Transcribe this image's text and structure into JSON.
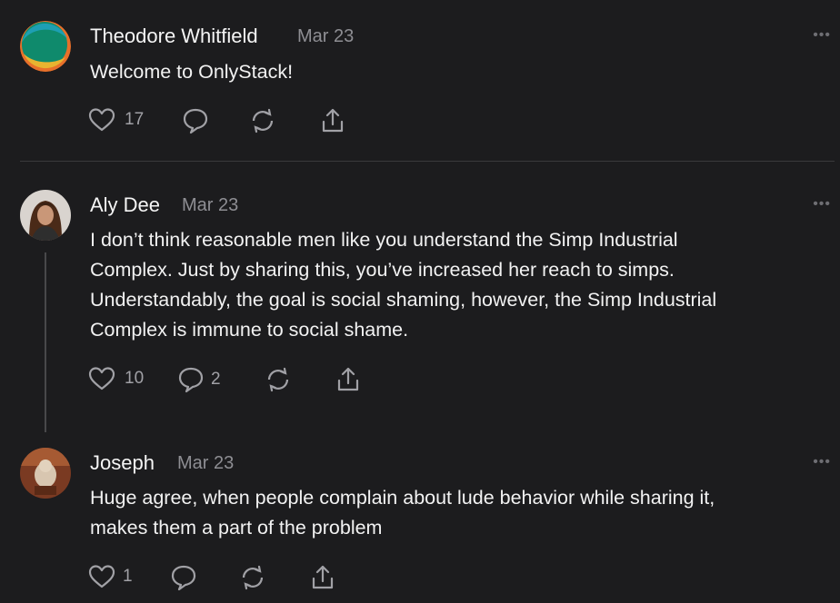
{
  "posts": [
    {
      "author": "Theodore Whitfield",
      "date": "Mar 23",
      "text": "Welcome to OnlyStack!",
      "likes": "17",
      "comments": "",
      "more": "•••"
    },
    {
      "author": "Aly Dee",
      "date": "Mar 23",
      "lines": [
        "I don’t think reasonable men like you understand the Simp Industrial",
        "Complex. Just by sharing this, you’ve increased her reach to simps.",
        "Understandably, the goal is social shaming, however, the Simp Industrial",
        "Complex is immune to social shame."
      ],
      "likes": "10",
      "comments": "2",
      "more": "•••"
    },
    {
      "author": "Joseph",
      "date": "Mar 23",
      "lines": [
        "Huge agree, when people complain about lude behavior while sharing it,",
        "makes them a part of the problem"
      ],
      "likes": "1",
      "comments": "",
      "more": "•••"
    }
  ],
  "icons": {
    "like": "heart-icon",
    "comment": "comment-icon",
    "restack": "restack-icon",
    "share": "share-icon"
  },
  "colors": {
    "background": "#1c1c1e",
    "text": "#f2f2f2",
    "muted": "#8e8e93",
    "divider": "#3a3a3c"
  }
}
